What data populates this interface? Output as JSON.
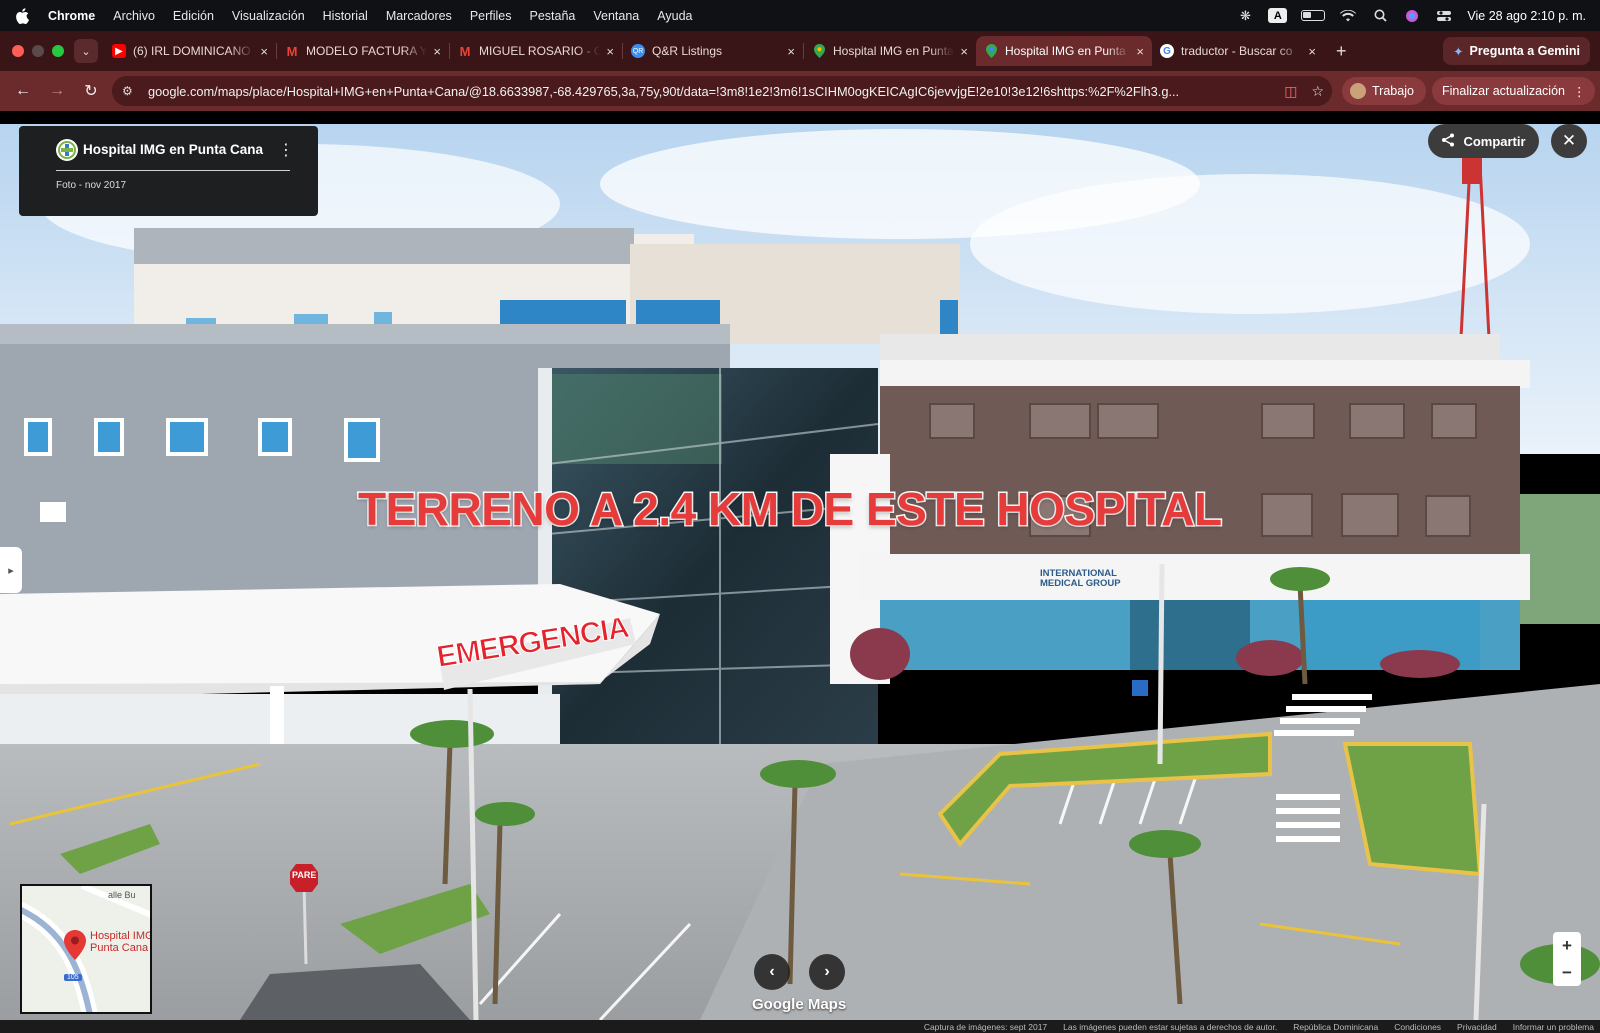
{
  "menubar": {
    "app": "Chrome",
    "items": [
      "Archivo",
      "Edición",
      "Visualización",
      "Historial",
      "Marcadores",
      "Perfiles",
      "Pestaña",
      "Ventana",
      "Ayuda"
    ],
    "clock": "Vie 28 ago 2:10 p. m.",
    "input_badge": "A"
  },
  "tabs": [
    {
      "title": "(6) IRL DOMINICANO",
      "favicon": "youtube-icon",
      "color": "#ff0000",
      "active": false
    },
    {
      "title": "MODELO FACTURA Y",
      "favicon": "gmail-icon",
      "color": "#ea4335",
      "active": false
    },
    {
      "title": "MIGUEL ROSARIO - C",
      "favicon": "gmail-icon",
      "color": "#ea4335",
      "active": false
    },
    {
      "title": "Q&R Listings",
      "favicon": "listings-icon",
      "color": "#3b8ff0",
      "active": false
    },
    {
      "title": "Hospital IMG en Punta",
      "favicon": "maps-pin-icon",
      "color": "#34a853",
      "active": false
    },
    {
      "title": "Hospital IMG en Punta",
      "favicon": "maps-pin-icon",
      "color": "#34a853",
      "active": true
    },
    {
      "title": "traductor - Buscar co",
      "favicon": "google-icon",
      "color": "#4285f4",
      "active": false
    }
  ],
  "gemini_button": "Pregunta a Gemini",
  "toolbar": {
    "url": "google.com/maps/place/Hospital+IMG+en+Punta+Cana/@18.6633987,-68.429765,3a,75y,90t/data=!3m8!1e2!3m6!1sCIHM0ogKEICAgIC6jevvjgE!2e10!3e12!6shttps:%2F%2Flh3.g...",
    "profile": "Trabajo",
    "update": "Finalizar actualización"
  },
  "streetview": {
    "place_name": "Hospital IMG en Punta Cana",
    "photo_date": "Foto - nov 2017",
    "share_label": "Compartir",
    "overlay_text": "TERRENO A 2.4 KM DE ESTE HOSPITAL",
    "signs": {
      "emergency": "EMERGENCIA",
      "company_line1": "INTERNATIONAL",
      "company_line2": "MEDICAL GROUP",
      "stop": "PARE"
    },
    "minimap": {
      "label": "Hospital IMG en Punta Cana",
      "road": "alle Bu",
      "shield": "105"
    },
    "logo": "Google Maps"
  },
  "attribution": [
    "Captura de imágenes: sept 2017",
    "Las imágenes pueden estar sujetas a derechos de autor.",
    "República Dominicana",
    "Condiciones",
    "Privacidad",
    "Informar un problema"
  ]
}
